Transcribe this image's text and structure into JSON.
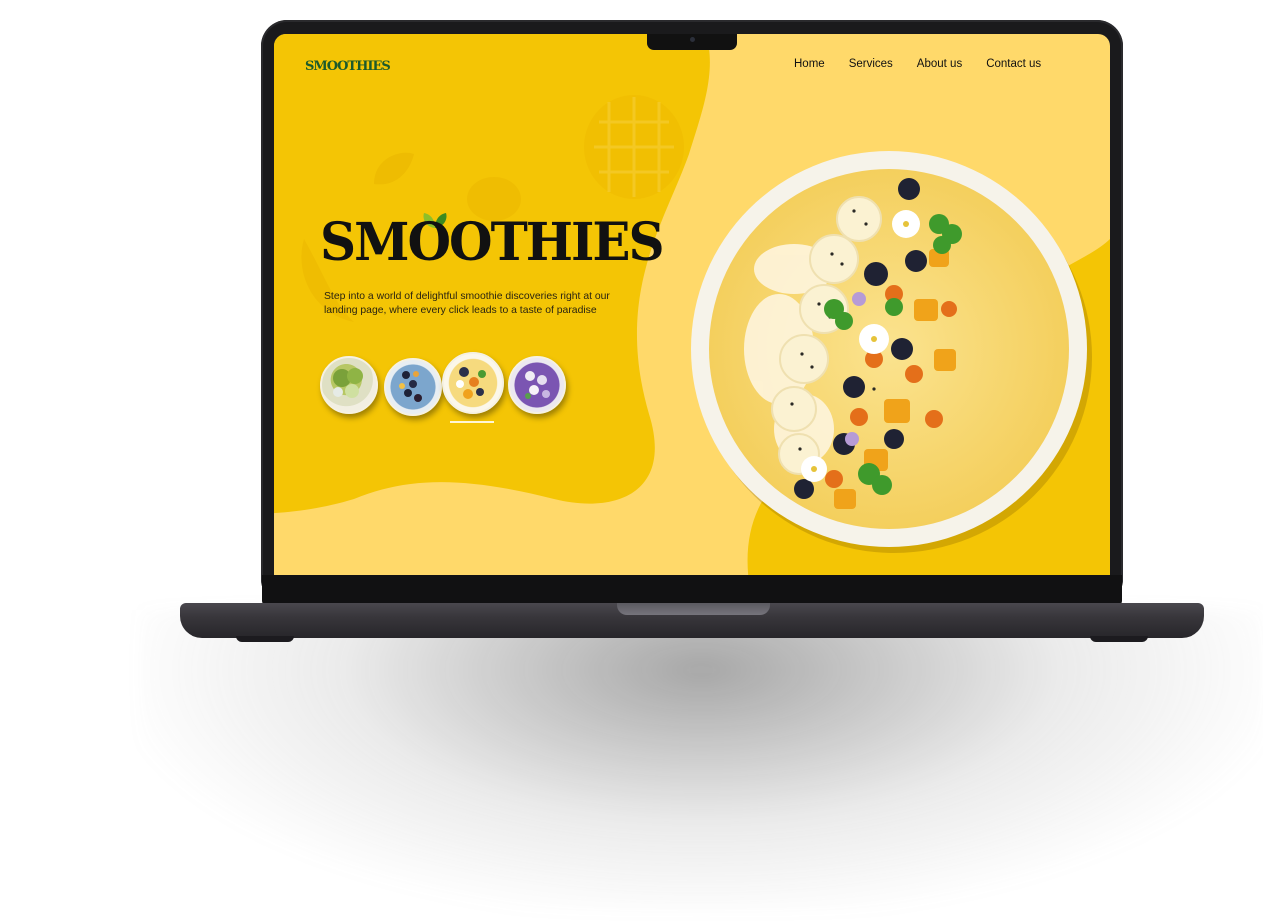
{
  "site": {
    "logo": "SMOOTHIES",
    "nav": [
      "Home",
      "Services",
      "About us",
      "Contact us"
    ],
    "hero_title": "SMOOTHIES",
    "hero_text": "Step into a world of delightful smoothie discoveries right at our landing page, where every click leads to a taste of paradise"
  },
  "thumbnails": [
    {
      "name": "kiwi-smoothie-bowl",
      "color": "#c8d48a",
      "selected": false
    },
    {
      "name": "blueberry-smoothie-bowl",
      "color": "#8fb6d8",
      "selected": false
    },
    {
      "name": "mango-smoothie-bowl",
      "color": "#f6d776",
      "selected": true
    },
    {
      "name": "berry-smoothie-bowl",
      "color": "#8a62b8",
      "selected": false
    }
  ],
  "colors": {
    "yellow_dark": "#f4c505",
    "yellow_light": "#ffd96a",
    "logo_green": "#1c5a2b",
    "bezel": "#1a1a1c"
  }
}
